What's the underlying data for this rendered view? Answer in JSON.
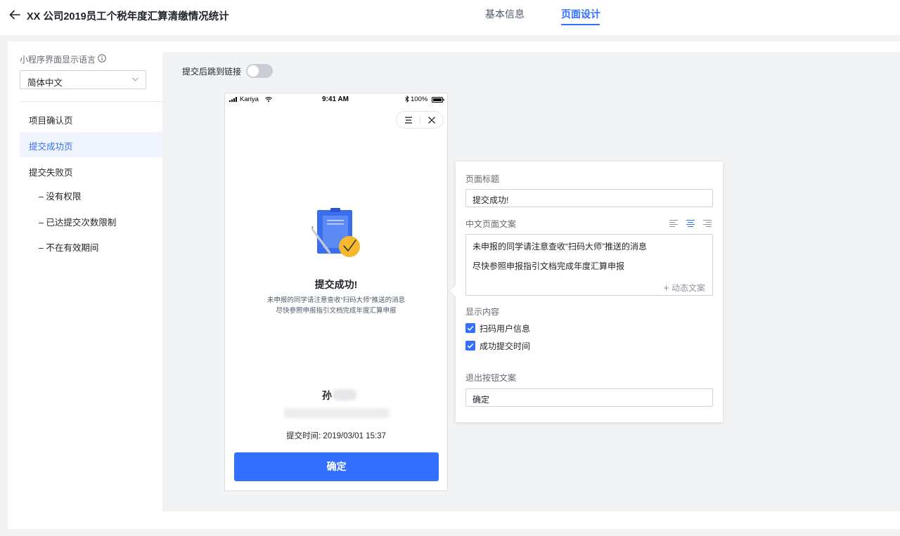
{
  "header": {
    "title": "XX 公司2019员工个税年度汇算清缴情况统计",
    "tabs": [
      {
        "label": "基本信息",
        "active": false
      },
      {
        "label": "页面设计",
        "active": true
      }
    ]
  },
  "sidebar": {
    "lang_label": "小程序界面显示语言",
    "lang_value": "简体中文",
    "items": [
      {
        "label": "项目确认页",
        "active": false
      },
      {
        "label": "提交成功页",
        "active": true
      },
      {
        "label": "提交失败页",
        "active": false
      },
      {
        "label": "– 没有权限",
        "active": false
      },
      {
        "label": "– 已达提交次数限制",
        "active": false
      },
      {
        "label": "– 不在有效期间",
        "active": false
      }
    ]
  },
  "canvas": {
    "toggle_label": "提交后跳到链接",
    "toggle_on": false
  },
  "phone": {
    "carrier": "Kariya",
    "time": "9:41 AM",
    "battery": "100%",
    "title": "提交成功!",
    "desc_line1": "未申报的同学请注意查收“扫码大师”推送的消息",
    "desc_line2": "尽快参照申报指引文档完成年度汇算申报",
    "user_name": "孙",
    "submit_time": "提交时间: 2019/03/01 15:37",
    "confirm_label": "确定"
  },
  "panel": {
    "title_label": "页面标题",
    "title_value": "提交成功!",
    "text_label": "中文页面文案",
    "text_line1": "未申报的同学请注意查收“扫码大师”推送的消息",
    "text_line2": "尽快参照申报指引文档完成年度汇算申报",
    "dynamic_label": "动态文案",
    "display_label": "显示内容",
    "checkbox1": "扫码用户信息",
    "checkbox2": "成功提交时间",
    "exit_label": "退出按钮文案",
    "exit_value": "确定"
  },
  "colors": {
    "accent": "#3370ff",
    "illustration_blue": "#3c6ff0",
    "illustration_yellow": "#f5b82e"
  }
}
